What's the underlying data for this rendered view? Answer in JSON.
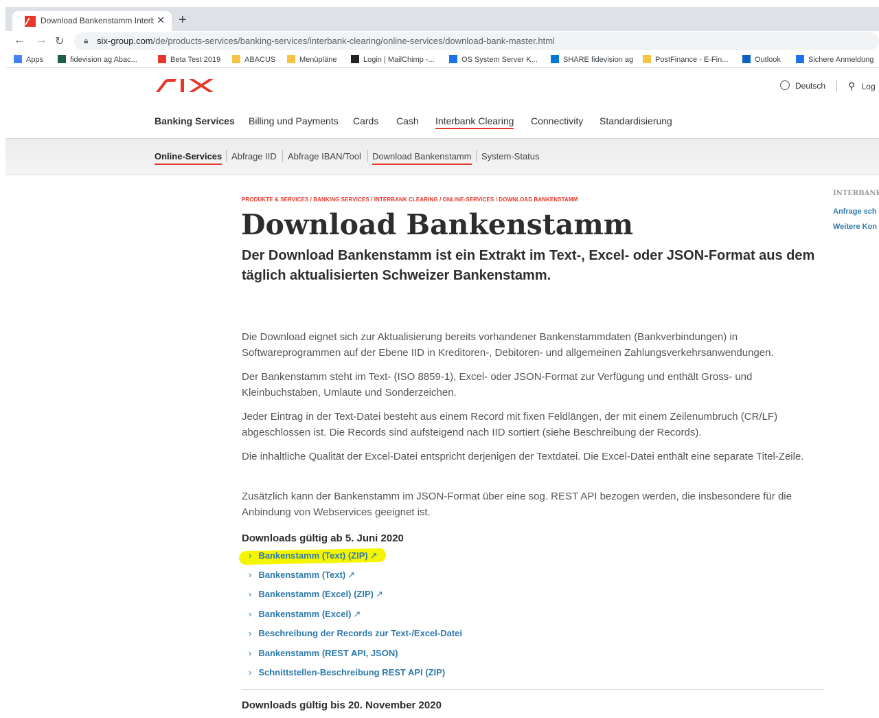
{
  "browser": {
    "tab_title": "Download Bankenstamm Interba",
    "tab_close": "✕",
    "new_tab": "+",
    "url_host": "six-group.com",
    "url_path": "/de/products-services/banking-services/interbank-clearing/online-services/download-bank-master.html",
    "bookmarks": [
      {
        "label": "Apps",
        "icon": "apps-grid-icon",
        "color": "#4285f4"
      },
      {
        "label": "fidevision ag  Abac...",
        "icon": "triangle-icon",
        "color": "#1b5e4a"
      },
      {
        "label": "Beta Test 2019",
        "icon": "dots-icon",
        "color": "#e5372a"
      },
      {
        "label": "ABACUS",
        "icon": "folder-icon",
        "color": "#f6c344"
      },
      {
        "label": "Menüpläne",
        "icon": "folder-icon",
        "color": "#f6c344"
      },
      {
        "label": "Login | MailChimp -...",
        "icon": "mailchimp-icon",
        "color": "#222222"
      },
      {
        "label": "OS System Server K...",
        "icon": "search-icon",
        "color": "#1a73e8"
      },
      {
        "label": "SHARE fidevision ag",
        "icon": "share-icon",
        "color": "#0078d4"
      },
      {
        "label": "PostFinance - E-Fin...",
        "icon": "postfinance-icon",
        "color": "#f6c344"
      },
      {
        "label": "Outlook",
        "icon": "outlook-icon",
        "color": "#0a64c0"
      },
      {
        "label": "Sichere Anmeldung",
        "icon": "secure-login-icon",
        "color": "#1a73e8"
      }
    ]
  },
  "header": {
    "logo_text": "SIX",
    "language": "Deutsch",
    "login": "Log",
    "brand_color": "#e5372a"
  },
  "main_nav": [
    "Banking Services",
    "Billing und Payments",
    "Cards",
    "Cash",
    "Interbank Clearing",
    "Connectivity",
    "Standardisierung"
  ],
  "sub_nav": [
    "Online-Services",
    "Abfrage IID",
    "Abfrage IBAN/Tool",
    "Download Bankenstamm",
    "System-Status"
  ],
  "content": {
    "breadcrumb": "PRODUKTE & SERVICES / BANKING SERVICES / INTERBANK CLEARING / ONLINE-SERVICES / DOWNLOAD BANKENSTAMM",
    "title": "Download Bankenstamm",
    "lead": "Der Download Bankenstamm ist ein Extrakt im Text-, Excel- oder JSON-Format aus dem täglich aktualisierten Schweizer Bankenstamm.",
    "paragraphs": [
      "Die Download eignet sich zur Aktualisierung bereits vorhandener Bankenstammdaten (Bankverbindungen) in Softwareprogrammen auf der Ebene IID in Kreditoren-, Debitoren- und allgemeinen Zahlungsverkehrsanwendungen.",
      "Der Bankenstamm steht im Text- (ISO 8859-1), Excel- oder JSON-Format zur Verfügung und enthält Gross- und Kleinbuchstaben, Umlaute und Sonderzeichen.",
      "Jeder Eintrag in der Text-Datei besteht aus einem Record mit fixen Feldlängen, der mit einem Zeilenumbruch (CR/LF) abgeschlossen ist. Die Records sind aufsteigend nach IID sortiert (siehe Beschreibung der Records).",
      "Die inhaltliche Qualität der Excel-Datei entspricht derjenigen der Textdatei. Die Excel-Datei enthält eine separate Titel-Zeile.",
      "Zusätzlich kann der Bankenstamm im JSON-Format über eine sog. REST API bezogen werden, die insbesondere für die Anbindung von Webservices geeignet ist."
    ],
    "downloads_heading_1": "Downloads gültig ab 5. Juni 2020",
    "downloads": [
      {
        "label": "Bankenstamm (Text) (ZIP)",
        "external": "↗"
      },
      {
        "label": "Bankenstamm (Text)",
        "external": "↗"
      },
      {
        "label": "Bankenstamm (Excel) (ZIP)",
        "external": "↗"
      },
      {
        "label": "Bankenstamm (Excel)",
        "external": "↗"
      },
      {
        "label": "Beschreibung der Records zur Text-/Excel-Datei",
        "external": ""
      },
      {
        "label": "Bankenstamm (REST API, JSON)",
        "external": ""
      },
      {
        "label": "Schnittstellen-Beschreibung REST API (ZIP)",
        "external": ""
      }
    ],
    "downloads_heading_2": "Downloads gültig bis 20. November 2020",
    "highlight_color": "#f5f500"
  },
  "sidebar": {
    "title": "INTERBANK",
    "links": [
      "Anfrage sch",
      "Weitere Kon"
    ]
  }
}
